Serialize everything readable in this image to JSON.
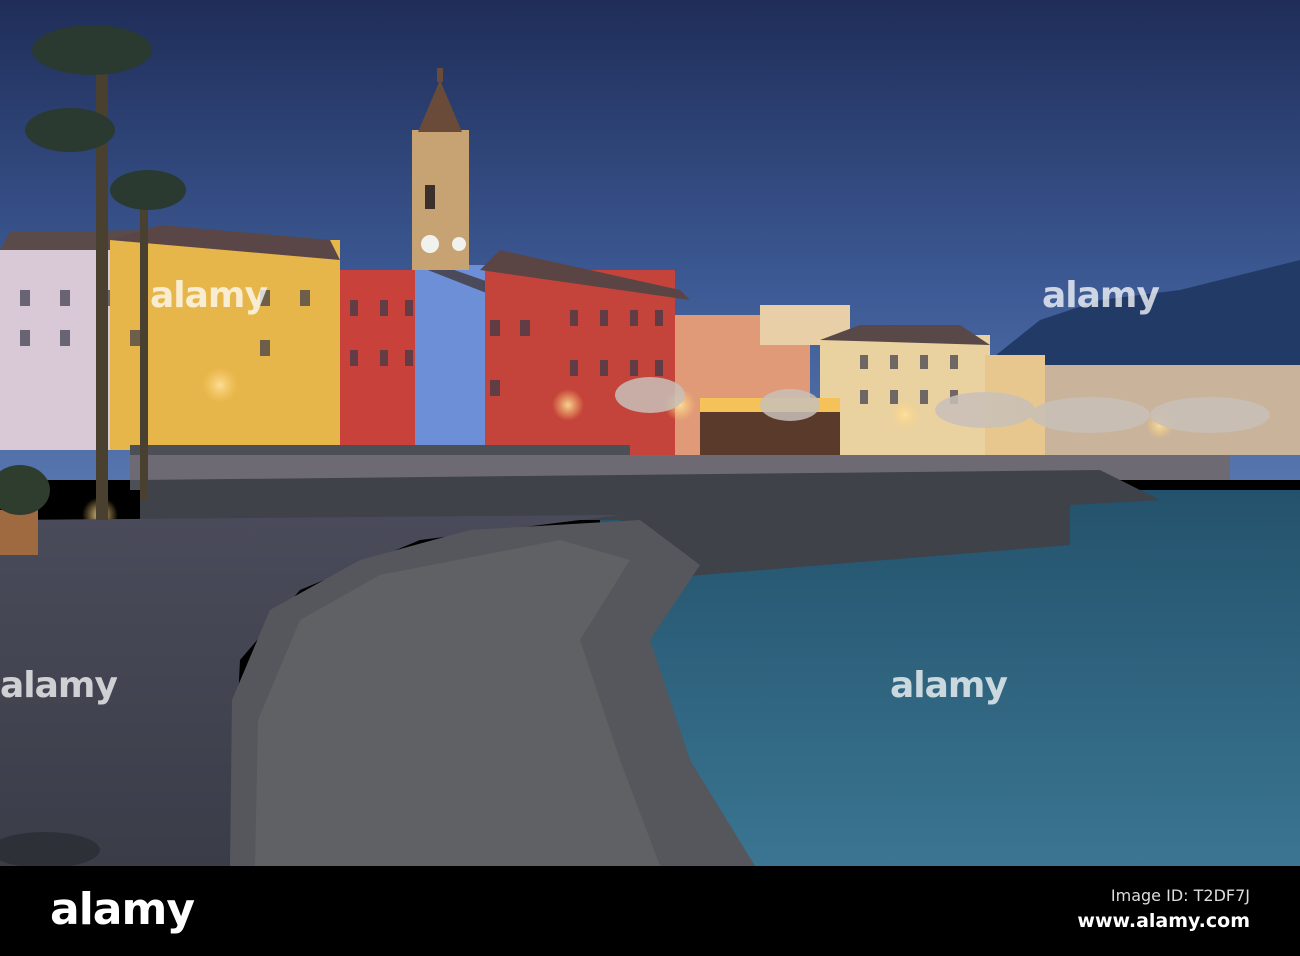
{
  "photo": {
    "subject": "Ascona lakeside promenade at dusk",
    "watermark_text": "alamy"
  },
  "footer": {
    "logo": "alamy",
    "image_id": "Image ID: T2DF7J",
    "website": "www.alamy.com"
  },
  "colors": {
    "sky_top": "#1f2f5a",
    "sky_bottom": "#4a6ba6",
    "water": "#2f6a85",
    "footer_bg": "#000000"
  }
}
